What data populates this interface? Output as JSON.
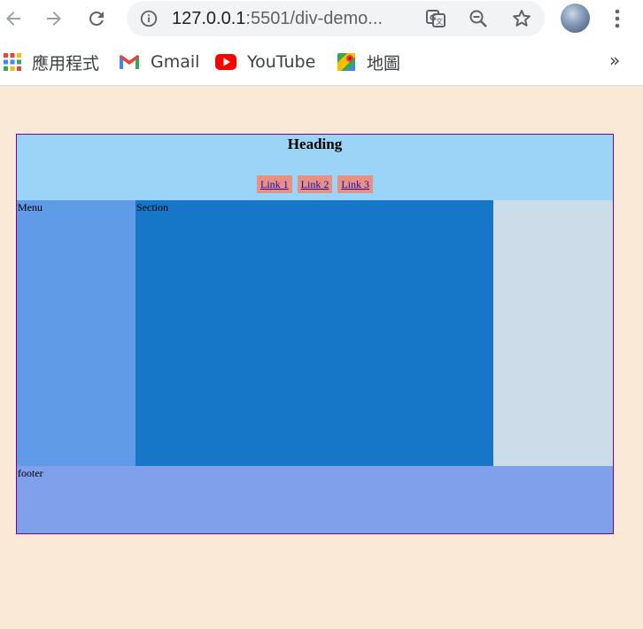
{
  "browser": {
    "url_host": "127.0.0.1",
    "url_rest": ":5501/div-demo...",
    "bookmarks": [
      {
        "label": "應用程式",
        "icon": "apps-grid-icon"
      },
      {
        "label": "Gmail",
        "icon": "gmail-icon"
      },
      {
        "label": "YouTube",
        "icon": "youtube-icon"
      },
      {
        "label": "地圖",
        "icon": "maps-icon"
      }
    ],
    "more": "»"
  },
  "page": {
    "heading": "Heading",
    "links": [
      "Link 1",
      "Link 2",
      "Link 3"
    ],
    "menu_label": "Menu",
    "section_label": "Section",
    "footer_label": "footer"
  },
  "colors": {
    "page_bg": "#fae9d6",
    "header_bg": "#9ad4f6",
    "link_bg": "#e79184",
    "menu_bg": "#5f9be6",
    "section_bg": "#1677c9",
    "aside_bg": "#cddce9",
    "footer_bg": "#7fa1ec",
    "wrapper_border": "#800080"
  }
}
